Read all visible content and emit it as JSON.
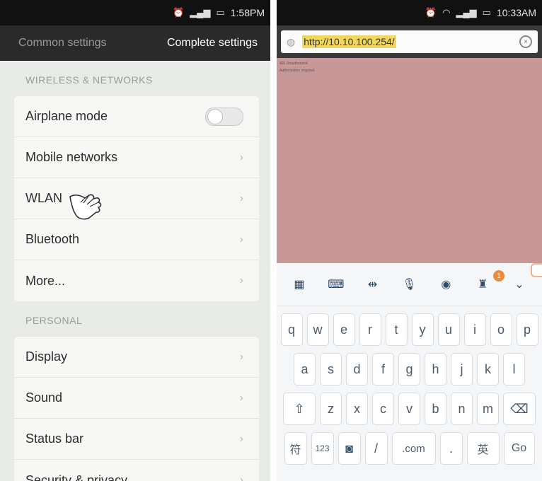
{
  "left": {
    "status": {
      "time": "1:58PM"
    },
    "tabs": [
      "Common settings",
      "Complete settings"
    ],
    "sections": [
      {
        "title": "WIRELESS & NETWORKS",
        "items": [
          "Airplane mode",
          "Mobile networks",
          "WLAN",
          "Bluetooth",
          "More..."
        ]
      },
      {
        "title": "PERSONAL",
        "items": [
          "Display",
          "Sound",
          "Status bar",
          "Security & privacy"
        ]
      }
    ],
    "airplane_toggle": "off"
  },
  "right": {
    "status": {
      "time": "10:33AM"
    },
    "url": "http://10.10.100.254/",
    "page_text": [
      "401 Unauthorized",
      "Authorization required."
    ],
    "keyboard": {
      "toolbar": [
        "apps-icon",
        "keyboard-icon",
        "cursor-icon",
        "mic-icon",
        "camera-icon",
        "tshirt-icon",
        "collapse-icon"
      ],
      "row1": [
        "q",
        "w",
        "e",
        "r",
        "t",
        "y",
        "u",
        "i",
        "o",
        "p"
      ],
      "row2": [
        "a",
        "s",
        "d",
        "f",
        "g",
        "h",
        "j",
        "k",
        "l"
      ],
      "row3": [
        "z",
        "x",
        "c",
        "v",
        "b",
        "n",
        "m"
      ],
      "bottom": {
        "sym": "符",
        "num": "123",
        "slash": "/",
        "com": ".com",
        "dot": ".",
        "lang": "英",
        "go": "Go"
      },
      "badge": "1"
    }
  },
  "colors": {
    "accent_url_highlight": "#f3d75c",
    "webpage_bg": "#c89797"
  }
}
